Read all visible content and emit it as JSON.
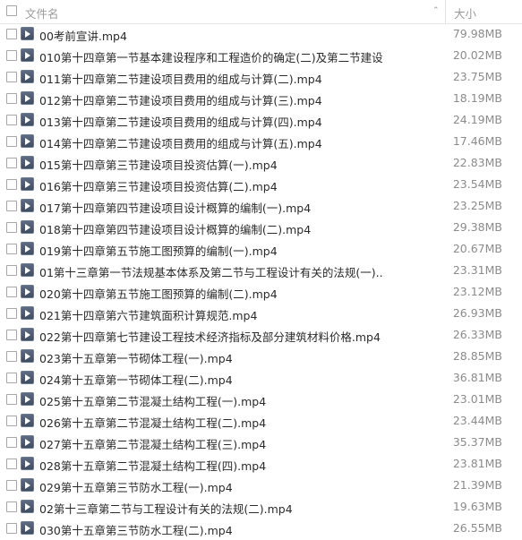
{
  "header": {
    "name_label": "文件名",
    "size_label": "大小"
  },
  "files": [
    {
      "name": "00考前宣讲.mp4",
      "size": "79.98MB"
    },
    {
      "name": "010第十四章第一节基本建设程序和工程造价的确定(二)及第二节建设...",
      "size": "20.02MB"
    },
    {
      "name": "011第十四章第二节建设项目费用的组成与计算(二).mp4",
      "size": "23.75MB"
    },
    {
      "name": "012第十四章第二节建设项目费用的组成与计算(三).mp4",
      "size": "18.19MB"
    },
    {
      "name": "013第十四章第二节建设项目费用的组成与计算(四).mp4",
      "size": "24.19MB"
    },
    {
      "name": "014第十四章第二节建设项目费用的组成与计算(五).mp4",
      "size": "17.46MB"
    },
    {
      "name": "015第十四章第三节建设项目投资估算(一).mp4",
      "size": "22.83MB"
    },
    {
      "name": "016第十四章第三节建设项目投资估算(二).mp4",
      "size": "23.54MB"
    },
    {
      "name": "017第十四章第四节建设项目设计概算的编制(一).mp4",
      "size": "23.25MB"
    },
    {
      "name": "018第十四章第四节建设项目设计概算的编制(二).mp4",
      "size": "29.38MB"
    },
    {
      "name": "019第十四章第五节施工图预算的编制(一).mp4",
      "size": "20.67MB"
    },
    {
      "name": "01第十三章第一节法规基本体系及第二节与工程设计有关的法规(一)....",
      "size": "23.31MB"
    },
    {
      "name": "020第十四章第五节施工图预算的编制(二).mp4",
      "size": "23.12MB"
    },
    {
      "name": "021第十四章第六节建筑面积计算规范.mp4",
      "size": "26.93MB"
    },
    {
      "name": "022第十四章第七节建设工程技术经济指标及部分建筑材料价格.mp4",
      "size": "26.33MB"
    },
    {
      "name": "023第十五章第一节砌体工程(一).mp4",
      "size": "28.85MB"
    },
    {
      "name": "024第十五章第一节砌体工程(二).mp4",
      "size": "36.81MB"
    },
    {
      "name": "025第十五章第二节混凝土结构工程(一).mp4",
      "size": "23.01MB"
    },
    {
      "name": "026第十五章第二节混凝土结构工程(二).mp4",
      "size": "23.44MB"
    },
    {
      "name": "027第十五章第二节混凝土结构工程(三).mp4",
      "size": "35.37MB"
    },
    {
      "name": "028第十五章第二节混凝土结构工程(四).mp4",
      "size": "23.81MB"
    },
    {
      "name": "029第十五章第三节防水工程(一).mp4",
      "size": "21.39MB"
    },
    {
      "name": "02第十三章第二节与工程设计有关的法规(二).mp4",
      "size": "19.63MB"
    },
    {
      "name": "030第十五章第三节防水工程(二).mp4",
      "size": "26.55MB"
    }
  ]
}
